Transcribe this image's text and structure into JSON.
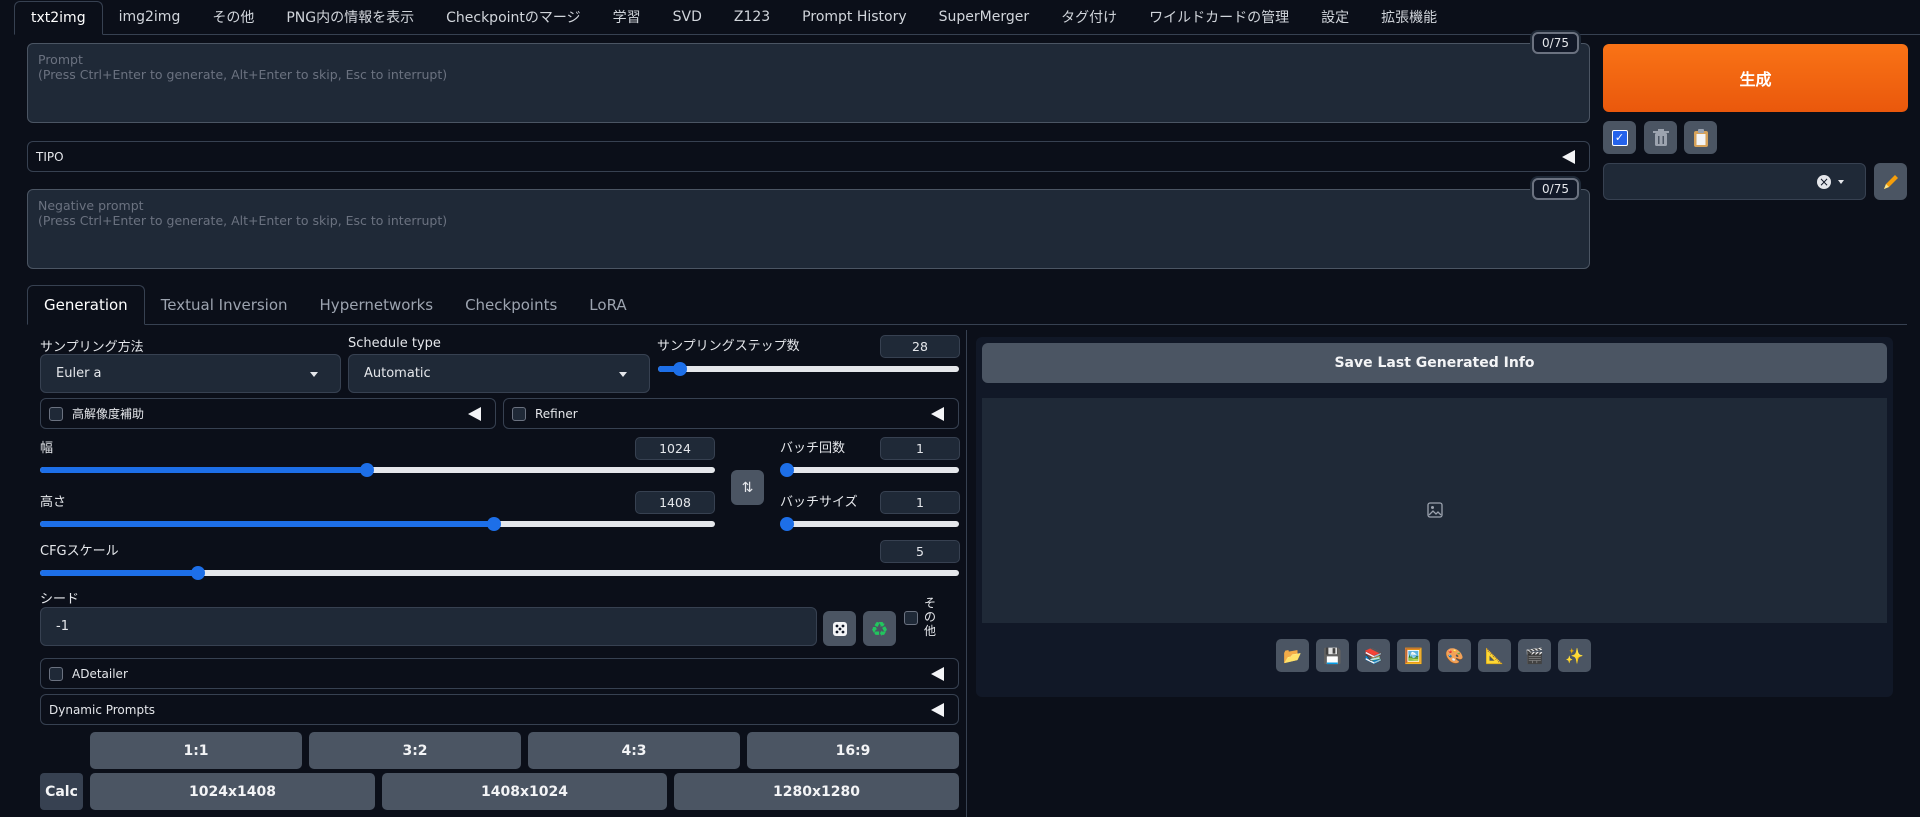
{
  "top_tabs": [
    "txt2img",
    "img2img",
    "その他",
    "PNG内の情報を表示",
    "Checkpointのマージ",
    "学習",
    "SVD",
    "Z123",
    "Prompt History",
    "SuperMerger",
    "タグ付け",
    "ワイルドカードの管理",
    "設定",
    "拡張機能"
  ],
  "prompt": {
    "token_count": "0/75",
    "placeholder": "Prompt\n(Press Ctrl+Enter to generate, Alt+Enter to skip, Esc to interrupt)"
  },
  "tipo": {
    "label": "TIPO"
  },
  "negative_prompt": {
    "token_count": "0/75",
    "placeholder": "Negative prompt\n(Press Ctrl+Enter to generate, Alt+Enter to skip, Esc to interrupt)"
  },
  "generate": {
    "label": "生成"
  },
  "style_select": {
    "clear": "×"
  },
  "mid_tabs": [
    "Generation",
    "Textual Inversion",
    "Hypernetworks",
    "Checkpoints",
    "LoRA"
  ],
  "sampling": {
    "method_label": "サンプリング方法",
    "method_value": "Euler a",
    "schedule_label": "Schedule type",
    "schedule_value": "Automatic",
    "steps_label": "サンプリングステップ数",
    "steps_value": "28",
    "steps_fraction": 0.074
  },
  "hires": {
    "label": "高解像度補助"
  },
  "refiner": {
    "label": "Refiner"
  },
  "width": {
    "label": "幅",
    "value": "1024",
    "fraction": 0.484
  },
  "height": {
    "label": "高さ",
    "value": "1408",
    "fraction": 0.672
  },
  "batch_count": {
    "label": "バッチ回数",
    "value": "1",
    "fraction": 0.0
  },
  "batch_size": {
    "label": "バッチサイズ",
    "value": "1",
    "fraction": 0.0
  },
  "cfg": {
    "label": "CFGスケール",
    "value": "5",
    "fraction": 0.172
  },
  "seed": {
    "label": "シード",
    "value": "-1",
    "extra_label": "その他"
  },
  "adetailer": {
    "label": "ADetailer"
  },
  "dynamic_prompts": {
    "label": "Dynamic Prompts"
  },
  "ratios": [
    "1:1",
    "3:2",
    "4:3",
    "16:9"
  ],
  "calc": {
    "label": "Calc"
  },
  "resolutions": [
    "1024x1408",
    "1408x1024",
    "1280x1280"
  ],
  "output": {
    "save_label": "Save Last Generated Info"
  },
  "toolbar_icons": [
    "📂",
    "💾",
    "📚",
    "🖼️",
    "🎨",
    "📐",
    "🎬",
    "✨"
  ],
  "colors": {
    "accent": "#f97316",
    "slider": "#1d6fe8",
    "background": "#0b0f19"
  }
}
